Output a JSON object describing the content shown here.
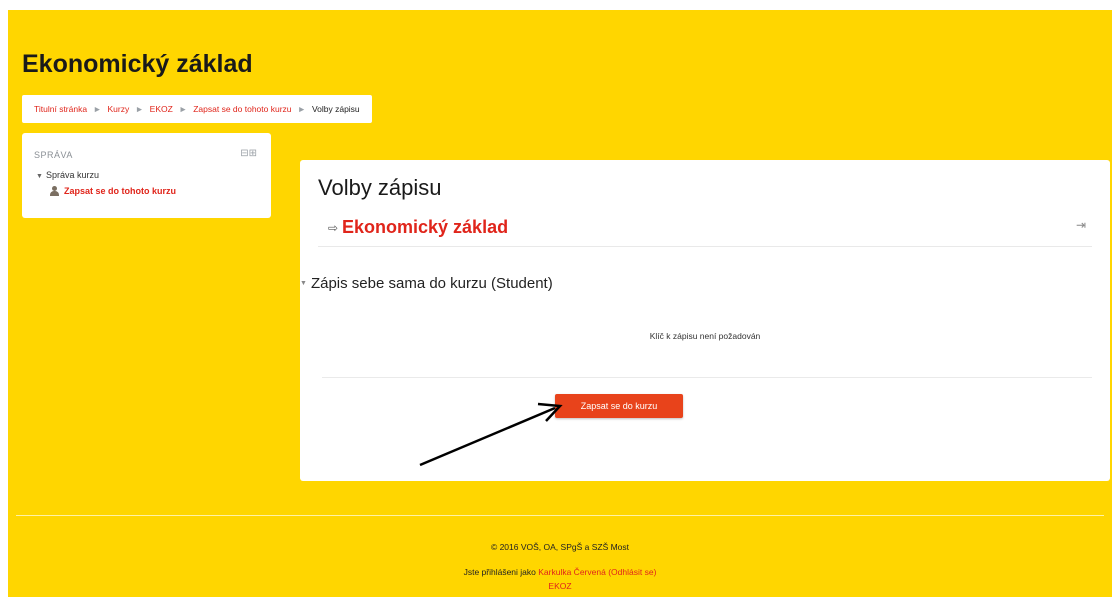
{
  "header": {
    "course_title": "Ekonomický základ"
  },
  "breadcrumb": {
    "items": [
      "Titulní stránka",
      "Kurzy",
      "EKOZ",
      "Zapsat se do tohoto kurzu"
    ],
    "current": "Volby zápisu",
    "separator": "►"
  },
  "block": {
    "title": "SPRÁVA",
    "controls": "⊟⊞",
    "root_item": "Správa kurzu",
    "child_item": "Zapsat se do tohoto kurzu"
  },
  "main": {
    "heading": "Volby zápisu",
    "course_name": "Ekonomický základ",
    "enrol_heading": "Zápis sebe sama do kurzu (Student)",
    "key_message": "Klíč k zápisu není požadován",
    "enrol_button": "Zapsat se do kurzu"
  },
  "footer": {
    "copyright": "© 2016 VOŠ, OA, SPgŠ a SZŠ Most",
    "logged_in_prefix": "Jste přihlášeni jako",
    "user_name": "Karkulka Červená",
    "logout_label": "Odhlásit se",
    "course_short": "EKOZ"
  },
  "colors": {
    "background": "#ffd600",
    "accent": "#e0251b",
    "button": "#e8431b"
  }
}
